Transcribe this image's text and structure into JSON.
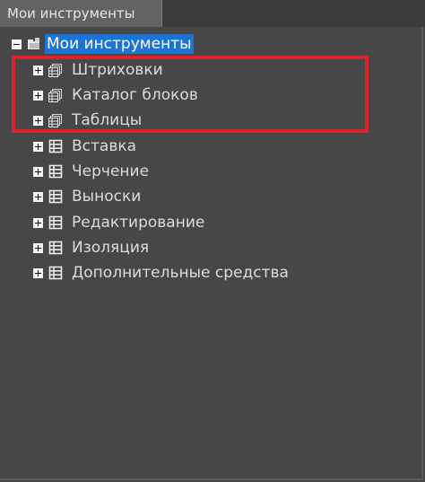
{
  "tab": {
    "label": "Мои инструменты"
  },
  "tree": {
    "root": {
      "label": "Мои инструменты",
      "expanded": true,
      "selected": true,
      "icon": "folder-open-icon"
    },
    "items": [
      {
        "label": "Штриховки",
        "icon": "palette-group-icon",
        "expanded": false
      },
      {
        "label": "Каталог блоков",
        "icon": "palette-group-icon",
        "expanded": false
      },
      {
        "label": "Таблицы",
        "icon": "palette-group-icon",
        "expanded": false
      },
      {
        "label": "Вставка",
        "icon": "palette-icon",
        "expanded": false
      },
      {
        "label": "Черчение",
        "icon": "palette-icon",
        "expanded": false
      },
      {
        "label": "Выноски",
        "icon": "palette-icon",
        "expanded": false
      },
      {
        "label": "Редактирование",
        "icon": "palette-icon",
        "expanded": false
      },
      {
        "label": "Изоляция",
        "icon": "palette-icon",
        "expanded": false
      },
      {
        "label": "Дополнительные средства",
        "icon": "palette-icon",
        "expanded": false
      }
    ]
  },
  "highlight": {
    "color": "#d9232d"
  },
  "colors": {
    "background": "#474747",
    "selection": "#1e74d3",
    "text": "#dcdcdc"
  }
}
